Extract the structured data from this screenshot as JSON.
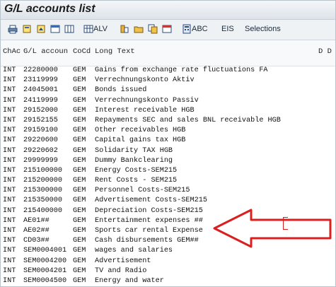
{
  "window": {
    "title": "G/L accounts list"
  },
  "toolbar": {
    "alv_label": "ALV",
    "abc_label": "ABC",
    "eis_label": "EIS",
    "selections_label": "Selections"
  },
  "header": {
    "col1": "ChAc",
    "col2": "G/L accoun",
    "col3": "CoCd",
    "col4": "Long Text",
    "right": "D D"
  },
  "rows": [
    {
      "chac": "INT",
      "account": "22280000",
      "cocd": "GEM",
      "text": "Gains from exchange rate fluctuations FA"
    },
    {
      "chac": "INT",
      "account": "23119999",
      "cocd": "GEM",
      "text": "Verrechnungskonto Aktiv"
    },
    {
      "chac": "INT",
      "account": "24045001",
      "cocd": "GEM",
      "text": "Bonds issued"
    },
    {
      "chac": "INT",
      "account": "24119999",
      "cocd": "GEM",
      "text": "Verrechnungskonto Passiv"
    },
    {
      "chac": "INT",
      "account": "29152000",
      "cocd": "GEM",
      "text": "Interest receivable HGB"
    },
    {
      "chac": "INT",
      "account": "29152155",
      "cocd": "GEM",
      "text": "Repayments SEC and sales BNL receivable HGB"
    },
    {
      "chac": "INT",
      "account": "29159100",
      "cocd": "GEM",
      "text": "Other receivables HGB"
    },
    {
      "chac": "INT",
      "account": "29220600",
      "cocd": "GEM",
      "text": "Capital gains tax HGB"
    },
    {
      "chac": "INT",
      "account": "29220602",
      "cocd": "GEM",
      "text": "Solidarity TAX HGB"
    },
    {
      "chac": "INT",
      "account": "29999999",
      "cocd": "GEM",
      "text": "Dummy Bankclearing"
    },
    {
      "chac": "INT",
      "account": "215100000",
      "cocd": "GEM",
      "text": "Energy Costs-SEM215"
    },
    {
      "chac": "INT",
      "account": "215200000",
      "cocd": "GEM",
      "text": "Rent Costs - SEM215"
    },
    {
      "chac": "INT",
      "account": "215300000",
      "cocd": "GEM",
      "text": "Personnel Costs-SEM215"
    },
    {
      "chac": "INT",
      "account": "215350000",
      "cocd": "GEM",
      "text": "Advertisement Costs-SEM215"
    },
    {
      "chac": "INT",
      "account": "215400000",
      "cocd": "GEM",
      "text": "Depreciation Costs-SEM215"
    },
    {
      "chac": "INT",
      "account": "AE01##",
      "cocd": "GEM",
      "text": "Entertainment expenses ##"
    },
    {
      "chac": "INT",
      "account": "AE02##",
      "cocd": "GEM",
      "text": "Sports car rental Expense"
    },
    {
      "chac": "INT",
      "account": "CD03##",
      "cocd": "GEM",
      "text": "Cash disbursements GEM##"
    },
    {
      "chac": "INT",
      "account": "SEM0004001",
      "cocd": "GEM",
      "text": "wages and salaries"
    },
    {
      "chac": "INT",
      "account": "SEM0004200",
      "cocd": "GEM",
      "text": "Advertisement"
    },
    {
      "chac": "INT",
      "account": "SEM0004201",
      "cocd": "GEM",
      "text": "TV and Radio"
    },
    {
      "chac": "INT",
      "account": "SEM0004500",
      "cocd": "GEM",
      "text": "Energy and water"
    }
  ],
  "colors": {
    "annotation": "#d92020",
    "cursor": "#1e4c9e"
  },
  "icons": [
    "printer-icon",
    "detail-icon",
    "sort-icon",
    "filter-icon",
    "layout-icon",
    "grid-icon",
    "column-icon",
    "folder-icon",
    "copy-icon",
    "calendar-icon",
    "calculator-icon"
  ]
}
